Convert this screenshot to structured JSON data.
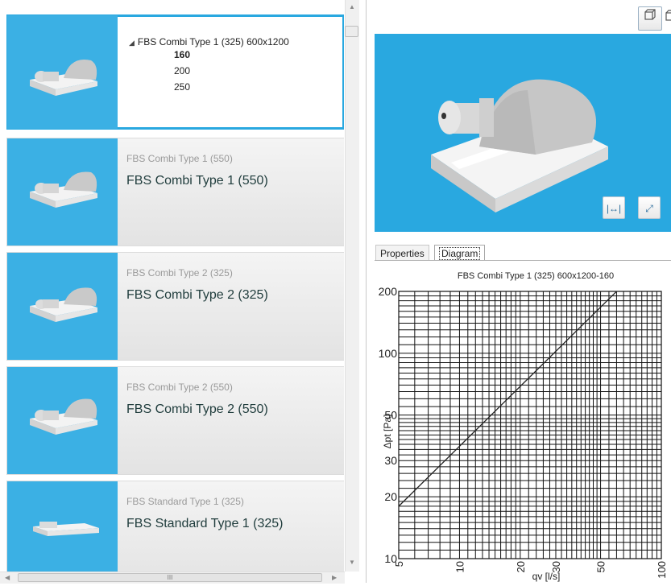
{
  "product_list": {
    "selected_card": {
      "header": "FBS Combi Type 1 (325) 600x1200",
      "sizes": [
        "160",
        "200",
        "250"
      ],
      "selected_size": "160"
    },
    "cards": [
      {
        "small_title": "FBS Combi Type 1 (550)",
        "title": "FBS Combi Type 1 (550)"
      },
      {
        "small_title": "FBS Combi Type 2 (325)",
        "title": "FBS Combi Type 2 (325)"
      },
      {
        "small_title": "FBS Combi Type 2 (550)",
        "title": "FBS Combi Type 2 (550)"
      },
      {
        "small_title": "FBS Standard Type 1 (325)",
        "title": "FBS Standard Type 1 (325)"
      }
    ]
  },
  "scrollbars": {
    "horizontal_thumb_grip": "III"
  },
  "viewer": {
    "icons": [
      "cube-view-icon",
      "multi-cube-view-icon",
      "fit-width-icon",
      "fullscreen-icon"
    ]
  },
  "tabs": [
    {
      "label": "Properties"
    },
    {
      "label": "Diagram",
      "active": true
    }
  ],
  "chart_data": {
    "type": "line",
    "title": "FBS Combi Type 1 (325) 600x1200-160",
    "xlabel": "qv [l/s]",
    "ylabel": "Δpt [Pa]",
    "xscale": "log",
    "yscale": "log",
    "xlim": [
      5,
      100
    ],
    "ylim": [
      10,
      200
    ],
    "xticks": [
      "5",
      "10",
      "20",
      "30",
      "50",
      "100"
    ],
    "yticks": [
      "10",
      "20",
      "30",
      "50",
      "100",
      "200"
    ],
    "grid": true,
    "series": [
      {
        "x": [
          5,
          60
        ],
        "y": [
          18,
          200
        ]
      }
    ],
    "colors": {
      "line": "#222222",
      "grid": "#111111"
    }
  },
  "colors": {
    "accent": "#29a8e0"
  }
}
